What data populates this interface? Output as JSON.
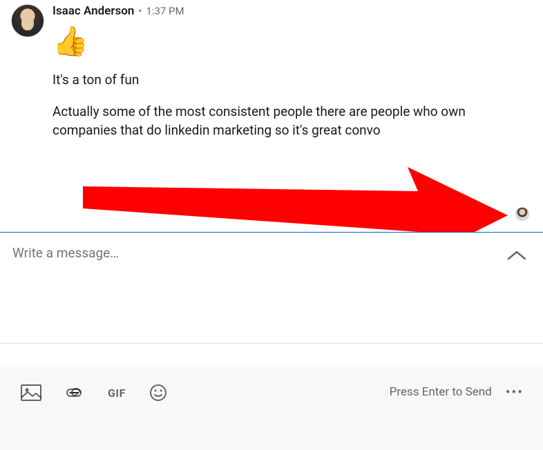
{
  "message": {
    "sender_name": "Isaac Anderson",
    "timestamp": "1:37 PM",
    "separator": "•",
    "emoji": "👍",
    "text1": "It's a ton of fun",
    "text2": "Actually some of the most consistent people there are people who own companies that do linkedin marketing so it's great convo"
  },
  "compose": {
    "placeholder": "Write a message…"
  },
  "toolbar": {
    "gif_label": "GIF",
    "press_enter": "Press Enter to Send",
    "more": "•••"
  },
  "icons": {
    "image": "image-icon",
    "attachment": "attachment-icon",
    "gif": "gif-icon",
    "emoji": "emoji-icon",
    "chevron": "chevron-up-icon",
    "more": "more-icon"
  },
  "annotation": {
    "arrow_color": "#ff0000"
  }
}
